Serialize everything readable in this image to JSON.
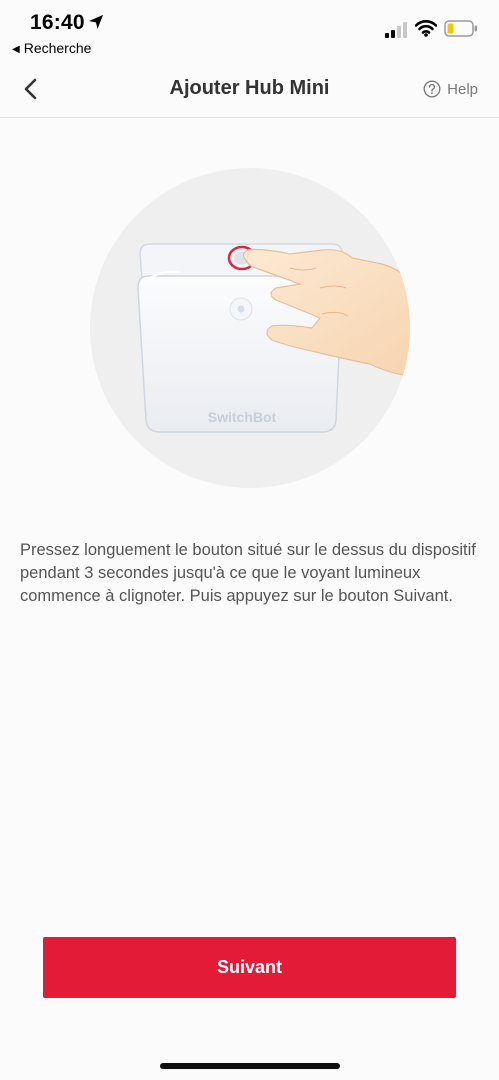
{
  "status_bar": {
    "time": "16:40",
    "back_app_label": "Recherche",
    "icons": [
      "location-arrow-icon",
      "cellular-signal-icon",
      "wifi-icon",
      "battery-low-icon"
    ],
    "battery_color": "#f1c40f"
  },
  "nav": {
    "title": "Ajouter Hub Mini",
    "help_label": "Help",
    "back_icon": "chevron-left-icon",
    "help_icon": "question-circle-icon"
  },
  "illustration": {
    "device_label": "SwitchBot",
    "highlight_color": "#d8283b"
  },
  "instruction": "Pressez longuement le bouton situé sur le dessus du dispositif pendant 3 secondes jusqu'à ce que le voyant lumineux commence à clignoter. Puis appuyez sur le bouton Suivant.",
  "next_button_label": "Suivant",
  "colors": {
    "accent": "#e31b36",
    "background": "#fbfbfb"
  }
}
